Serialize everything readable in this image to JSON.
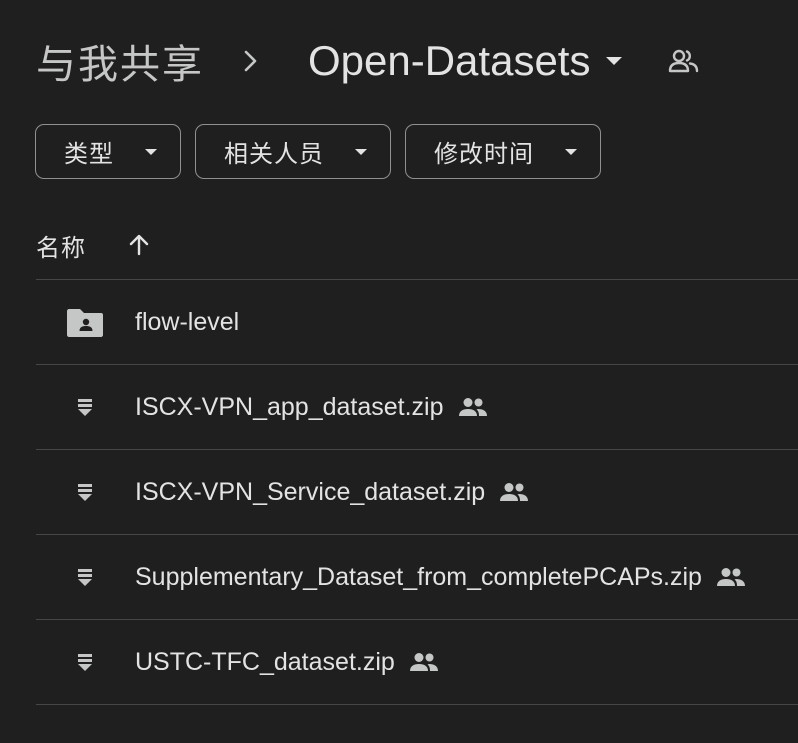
{
  "breadcrumb": {
    "root": "与我共享",
    "current": "Open-Datasets"
  },
  "filters": [
    {
      "label": "类型"
    },
    {
      "label": "相关人员"
    },
    {
      "label": "修改时间"
    }
  ],
  "columns": {
    "name": "名称"
  },
  "files": [
    {
      "name": "flow-level",
      "type": "shared-folder",
      "icon": "shared-folder-icon",
      "shared": false
    },
    {
      "name": "ISCX-VPN_app_dataset.zip",
      "type": "zip",
      "icon": "zip-file-icon",
      "shared": true
    },
    {
      "name": "ISCX-VPN_Service_dataset.zip",
      "type": "zip",
      "icon": "zip-file-icon",
      "shared": true
    },
    {
      "name": "Supplementary_Dataset_from_completePCAPs.zip",
      "type": "zip",
      "icon": "zip-file-icon",
      "shared": true
    },
    {
      "name": "USTC-TFC_dataset.zip",
      "type": "zip",
      "icon": "zip-file-icon",
      "shared": true
    }
  ],
  "colors": {
    "background": "#1f1f1f",
    "text": "#e3e3e3",
    "muted": "#c4c7c5",
    "divider": "#444746",
    "chip_border": "#8e918f"
  }
}
